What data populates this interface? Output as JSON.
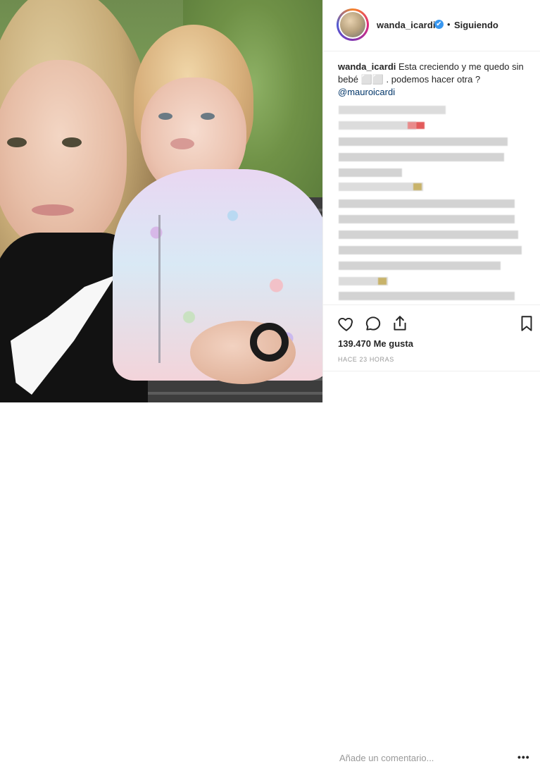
{
  "header": {
    "username": "wanda_icardi",
    "separator": "•",
    "follow_label": "Siguiendo",
    "verified_mark": "✔"
  },
  "caption": {
    "username": "wanda_icardi",
    "text": "Esta creciendo y me quedo sin bebé ⬜⬜ . podemos hacer otra ?",
    "mention": "@mauroicardi"
  },
  "actions": {
    "like_icon": "heart-icon",
    "comment_icon": "comment-icon",
    "share_icon": "share-icon",
    "save_icon": "bookmark-icon"
  },
  "stats": {
    "likes_label": "139.470 Me gusta",
    "timestamp": "HACE 23 HORAS"
  },
  "comment_box": {
    "placeholder": "Añade un comentario...",
    "more": "•••"
  },
  "colors": {
    "accent": "#3897f0",
    "mention": "#003569",
    "muted": "#999999"
  }
}
